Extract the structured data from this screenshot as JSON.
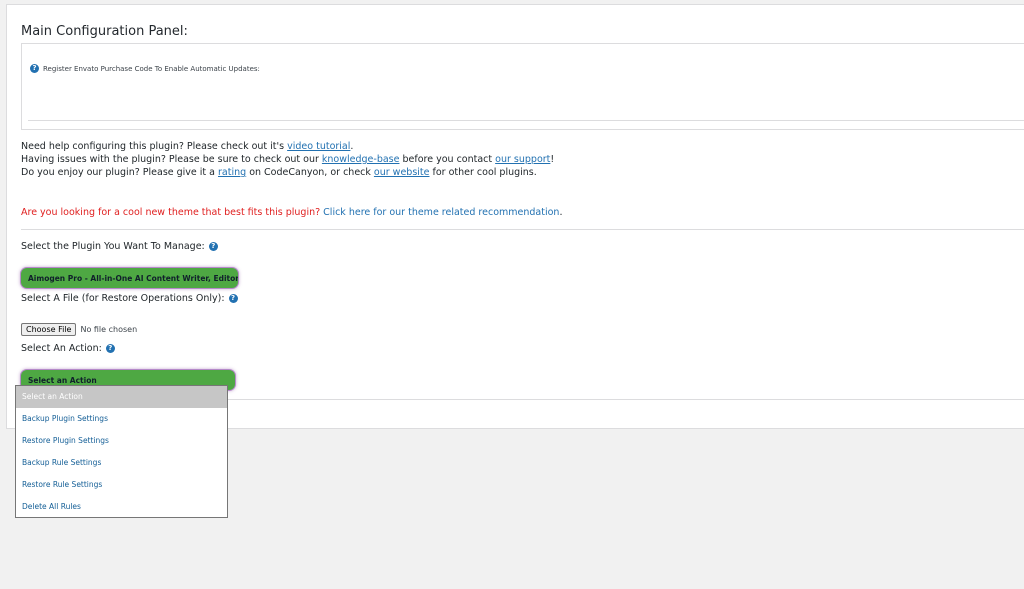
{
  "panel": {
    "title": "Main Configuration Panel:",
    "update_label": "Register Envato Purchase Code To Enable Automatic Updates:"
  },
  "help": {
    "line1_prefix": "Need help configuring this plugin? Please check out it's ",
    "line1_link": "video tutorial",
    "line1_suffix": ".",
    "line2_prefix": "Having issues with the plugin? Please be sure to check out our ",
    "line2_link1": "knowledge-base",
    "line2_middle": " before you contact ",
    "line2_link2": "our support",
    "line2_suffix": "!",
    "line3_prefix": "Do you enjoy our plugin? Please give it a ",
    "line3_link1": "rating",
    "line3_middle": " on CodeCanyon, or check ",
    "line3_link2": "our website",
    "line3_suffix": " for other cool plugins."
  },
  "promo": {
    "question": "Are you looking for a cool new theme that best fits this plugin? ",
    "link": "Click here for our theme related recommendation",
    "suffix": "."
  },
  "form": {
    "plugin_label": "Select the Plugin You Want To Manage:",
    "plugin_selected": "Aimogen Pro - All-in-One AI Content Writer, Editor,",
    "file_label": "Select A File (for Restore Operations Only):",
    "file_button": "Choose File",
    "file_status": "No file chosen",
    "action_label": "Select An Action:",
    "action_selected": "Select an Action",
    "action_options": [
      "Select an Action",
      "Backup Plugin Settings",
      "Restore Plugin Settings",
      "Backup Rule Settings",
      "Restore Rule Settings",
      "Delete All Rules"
    ]
  },
  "icons": {
    "help": "question-circle-icon",
    "help_glyph": "?"
  },
  "colors": {
    "accent_link": "#2271b1",
    "promo_red": "#e02020",
    "select_green": "#4ea843"
  }
}
